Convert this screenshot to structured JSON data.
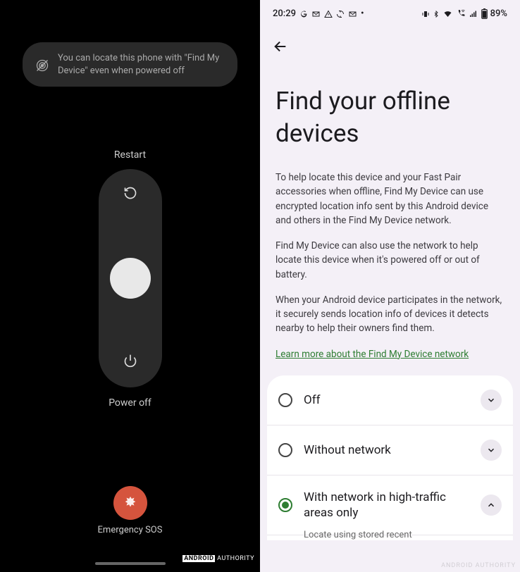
{
  "left": {
    "banner_text": "You can locate this phone with \"Find My Device\" even when powered off",
    "restart_label": "Restart",
    "poweroff_label": "Power off",
    "sos_label": "Emergency SOS",
    "watermark_bold": "ANDROID",
    "watermark_rest": " AUTHORITY"
  },
  "right": {
    "status": {
      "time": "20:29",
      "battery_pct": "89%"
    },
    "title": "Find your offline devices",
    "body_p1": "To help locate this device and your Fast Pair accessories when offline, Find My Device can use encrypted location info sent by this Android device and others in the Find My Device network.",
    "body_p2": "Find My Device can also use the network to help locate this device when it's powered off or out of battery.",
    "body_p3": "When your Android device participates in the network, it securely sends location info of devices it detects nearby to help their owners find them.",
    "link_text": "Learn more about the Find My Device network",
    "options": [
      {
        "label": "Off",
        "selected": false,
        "expanded": false
      },
      {
        "label": "Without network",
        "selected": false,
        "expanded": false
      },
      {
        "label": "With network in high-traffic areas only",
        "selected": true,
        "expanded": true
      }
    ],
    "option_sub_cut": "Locate using stored recent",
    "watermark": "ANDROID AUTHORITY"
  }
}
